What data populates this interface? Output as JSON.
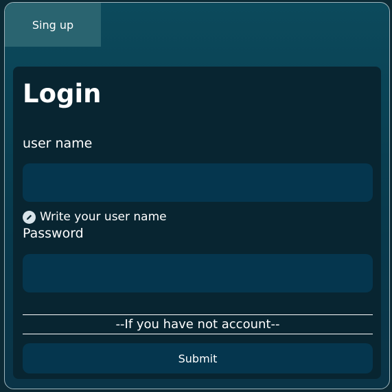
{
  "tabs": {
    "signup_label": "Sing up"
  },
  "login": {
    "title": "Login",
    "username_label": "user name",
    "username_value": "",
    "username_hint": "Write your user name",
    "hint_icon": "pencil-icon",
    "password_label": "Password",
    "password_value": "",
    "divider_text": "--If you have not account--",
    "submit_label": "Submit"
  },
  "colors": {
    "background": "#0c2a35",
    "card_gradient_top": "#0c4a5c",
    "panel": "#082531",
    "input": "#05364e",
    "tab": "#2a6470",
    "text": "#ffffff"
  }
}
